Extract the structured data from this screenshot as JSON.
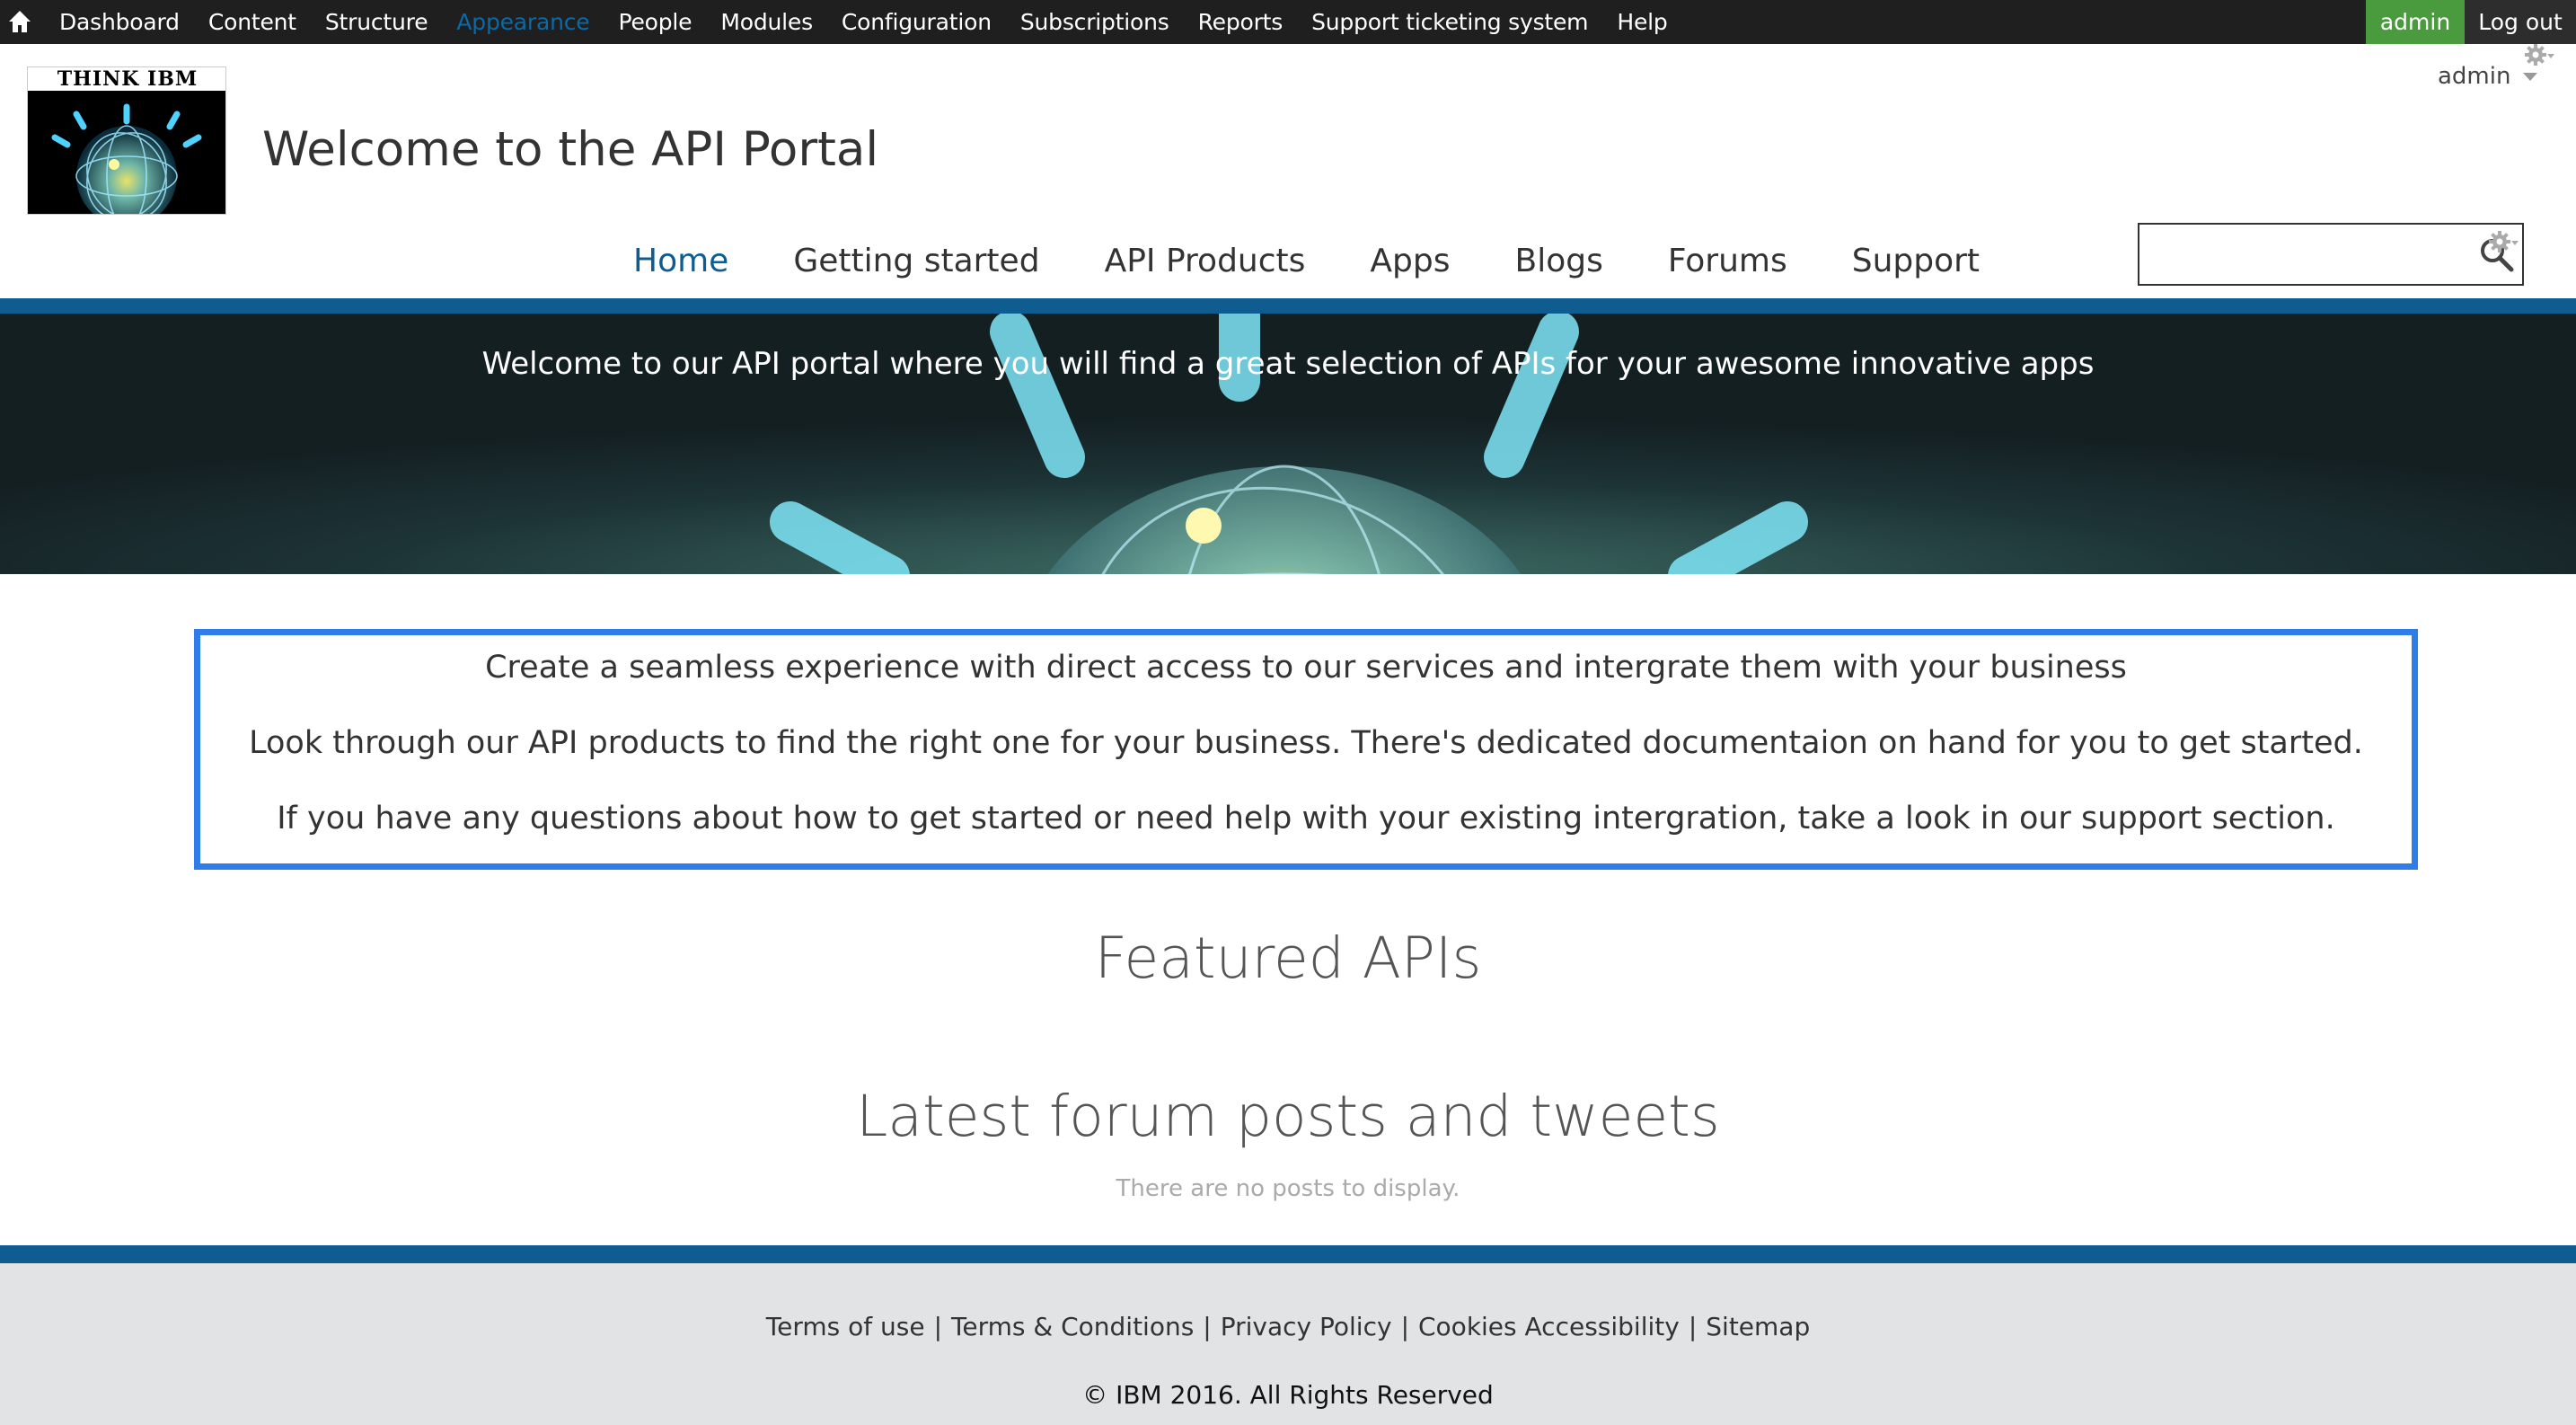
{
  "toolbar": {
    "menu": [
      "Dashboard",
      "Content",
      "Structure",
      "Appearance",
      "People",
      "Modules",
      "Configuration",
      "Subscriptions",
      "Reports",
      "Support ticketing system",
      "Help"
    ],
    "active_item": "Appearance",
    "user_label": "admin",
    "logout_label": "Log out",
    "user_bg": "#4a9b3e"
  },
  "header": {
    "logo_text": "THINK IBM",
    "site_name": "Welcome to the API Portal",
    "user_menu_label": "admin"
  },
  "nav": {
    "items": [
      "Home",
      "Getting started",
      "API Products",
      "Apps",
      "Blogs",
      "Forums",
      "Support"
    ],
    "active": "Home"
  },
  "search": {
    "value": "",
    "placeholder": ""
  },
  "hero": {
    "text": "Welcome to our API portal where you will find a great selection of APIs for your awesome innovative apps"
  },
  "intro": {
    "line1": "Create a seamless experience with direct access to our services and intergrate them with your business",
    "line2": "Look through our API products to find the right one for your business. There's dedicated documentaion on hand for you to get started.",
    "line3": "If you have any questions about how to get started or need help with your existing intergration, take a look in our support section."
  },
  "featured": {
    "title": "Featured APIs"
  },
  "forum": {
    "title": "Latest forum posts and tweets",
    "empty_text": "There are no posts to display."
  },
  "footer": {
    "links": [
      "Terms of use",
      "Terms & Conditions",
      "Privacy Policy",
      "Cookies Accessibility",
      "Sitemap"
    ],
    "copyright": "© IBM 2016. All Rights Reserved"
  },
  "colors": {
    "brand_blue": "#0f5c91",
    "intro_border": "#2e7de8",
    "toolbar_bg": "#1f1f1f",
    "footer_bg": "#e2e3e5"
  }
}
